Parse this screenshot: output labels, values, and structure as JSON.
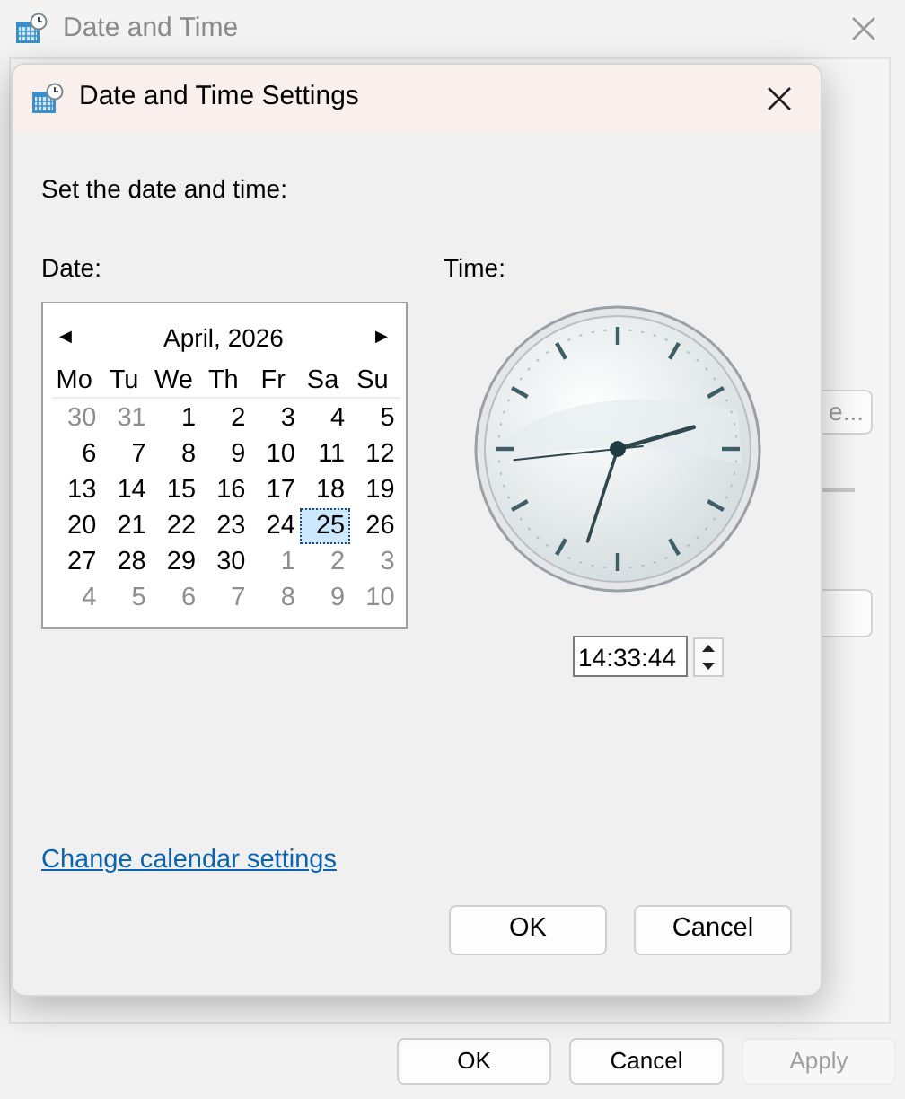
{
  "window": {
    "title": "Date and Time",
    "partial_button": "e...",
    "buttons": [
      {
        "label": "OK",
        "disabled": false
      },
      {
        "label": "Cancel",
        "disabled": false
      },
      {
        "label": "Apply",
        "disabled": true
      }
    ]
  },
  "dialog": {
    "title": "Date and Time Settings",
    "prompt": "Set the date and time:",
    "date_label": "Date:",
    "time_label": "Time:",
    "calendar": {
      "month": "April, 2026",
      "prev": "◀",
      "next": "▶",
      "weekdays": [
        "Mo",
        "Tu",
        "We",
        "Th",
        "Fr",
        "Sa",
        "Su"
      ],
      "weeks": [
        [
          {
            "day": "30",
            "in_month": false,
            "selected": false
          },
          {
            "day": "31",
            "in_month": false,
            "selected": false
          },
          {
            "day": "1",
            "in_month": true,
            "selected": false
          },
          {
            "day": "2",
            "in_month": true,
            "selected": false
          },
          {
            "day": "3",
            "in_month": true,
            "selected": false
          },
          {
            "day": "4",
            "in_month": true,
            "selected": false
          },
          {
            "day": "5",
            "in_month": true,
            "selected": false
          }
        ],
        [
          {
            "day": "6",
            "in_month": true,
            "selected": false
          },
          {
            "day": "7",
            "in_month": true,
            "selected": false
          },
          {
            "day": "8",
            "in_month": true,
            "selected": false
          },
          {
            "day": "9",
            "in_month": true,
            "selected": false
          },
          {
            "day": "10",
            "in_month": true,
            "selected": false
          },
          {
            "day": "11",
            "in_month": true,
            "selected": false
          },
          {
            "day": "12",
            "in_month": true,
            "selected": false
          }
        ],
        [
          {
            "day": "13",
            "in_month": true,
            "selected": false
          },
          {
            "day": "14",
            "in_month": true,
            "selected": false
          },
          {
            "day": "15",
            "in_month": true,
            "selected": false
          },
          {
            "day": "16",
            "in_month": true,
            "selected": false
          },
          {
            "day": "17",
            "in_month": true,
            "selected": false
          },
          {
            "day": "18",
            "in_month": true,
            "selected": false
          },
          {
            "day": "19",
            "in_month": true,
            "selected": false
          }
        ],
        [
          {
            "day": "20",
            "in_month": true,
            "selected": false
          },
          {
            "day": "21",
            "in_month": true,
            "selected": false
          },
          {
            "day": "22",
            "in_month": true,
            "selected": false
          },
          {
            "day": "23",
            "in_month": true,
            "selected": false
          },
          {
            "day": "24",
            "in_month": true,
            "selected": false
          },
          {
            "day": "25",
            "in_month": true,
            "selected": true
          },
          {
            "day": "26",
            "in_month": true,
            "selected": false
          }
        ],
        [
          {
            "day": "27",
            "in_month": true,
            "selected": false
          },
          {
            "day": "28",
            "in_month": true,
            "selected": false
          },
          {
            "day": "29",
            "in_month": true,
            "selected": false
          },
          {
            "day": "30",
            "in_month": true,
            "selected": false
          },
          {
            "day": "1",
            "in_month": false,
            "selected": false
          },
          {
            "day": "2",
            "in_month": false,
            "selected": false
          },
          {
            "day": "3",
            "in_month": false,
            "selected": false
          }
        ],
        [
          {
            "day": "4",
            "in_month": false,
            "selected": false
          },
          {
            "day": "5",
            "in_month": false,
            "selected": false
          },
          {
            "day": "6",
            "in_month": false,
            "selected": false
          },
          {
            "day": "7",
            "in_month": false,
            "selected": false
          },
          {
            "day": "8",
            "in_month": false,
            "selected": false
          },
          {
            "day": "9",
            "in_month": false,
            "selected": false
          },
          {
            "day": "10",
            "in_month": false,
            "selected": false
          }
        ]
      ]
    },
    "time_value": "14:33:44",
    "link": "Change calendar settings",
    "buttons": [
      "OK",
      "Cancel"
    ]
  }
}
